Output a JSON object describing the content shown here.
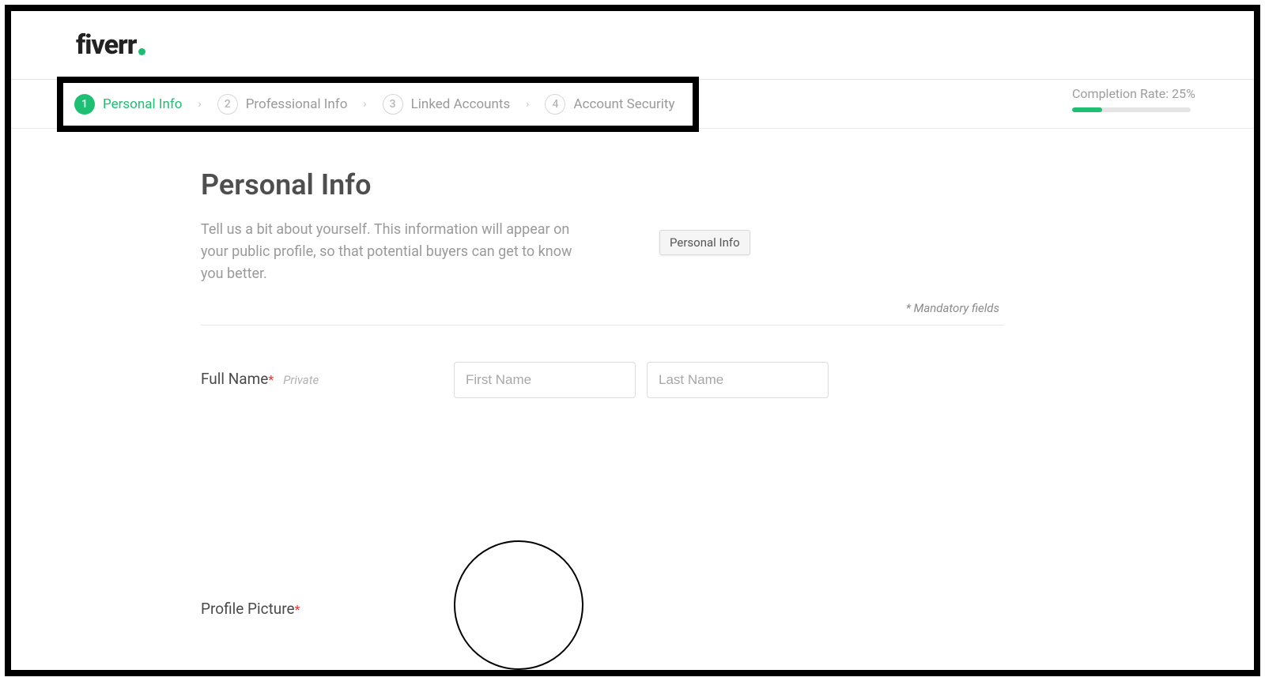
{
  "brand": {
    "name": "fiverr"
  },
  "stepper": {
    "steps": [
      {
        "num": "1",
        "label": "Personal Info",
        "active": true
      },
      {
        "num": "2",
        "label": "Professional Info",
        "active": false
      },
      {
        "num": "3",
        "label": "Linked Accounts",
        "active": false
      },
      {
        "num": "4",
        "label": "Account Security",
        "active": false
      }
    ]
  },
  "completion": {
    "label": "Completion Rate: 25%",
    "percent": 25
  },
  "page": {
    "title": "Personal Info",
    "intro": "Tell us a bit about yourself. This information will appear on your public profile, so that potential buyers can get to know you better.",
    "chip": "Personal Info",
    "mandatory_note": "* Mandatory fields"
  },
  "form": {
    "full_name": {
      "label": "Full Name",
      "private": "Private",
      "first_placeholder": "First Name",
      "last_placeholder": "Last Name"
    },
    "profile_picture": {
      "label": "Profile Picture"
    }
  }
}
